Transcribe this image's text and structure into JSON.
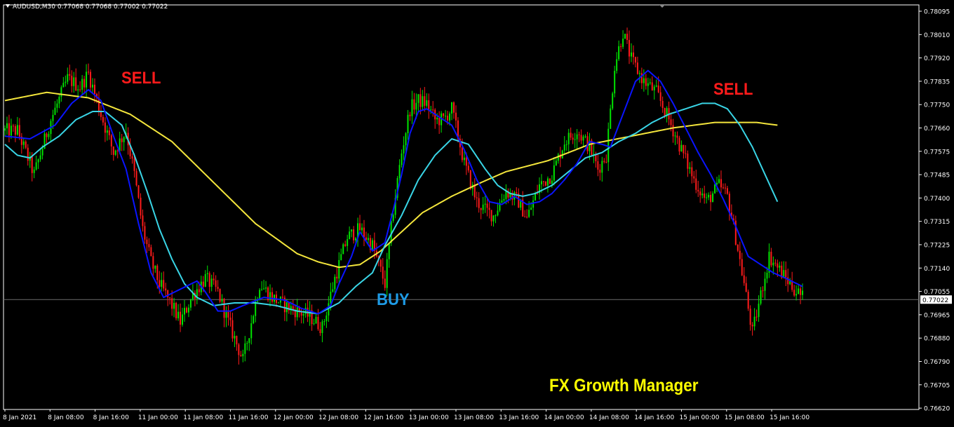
{
  "header": {
    "symbol_info": "AUDUSD,M30  0.77068 0.77068 0.77002 0.77022"
  },
  "annotations": {
    "sell_left": "SELL",
    "sell_right": "SELL",
    "buy": "BUY",
    "brand": "FX Growth Manager"
  },
  "colors": {
    "background": "#000000",
    "bull": "#00e400",
    "bear": "#ff1b1b",
    "ma_fast": "#0a14ff",
    "ma_mid": "#39d5e6",
    "ma_slow": "#f4e63c",
    "axis": "#ffffff",
    "current_price_line": "#6a6a6a"
  },
  "chart_data": {
    "type": "candlestick",
    "symbol": "AUDUSD",
    "timeframe": "M30",
    "ylim": [
      0.7662,
      0.781
    ],
    "y_ticks": [
      "0.78095",
      "0.78010",
      "0.77920",
      "0.77835",
      "0.77750",
      "0.77660",
      "0.77575",
      "0.77485",
      "0.77400",
      "0.77315",
      "0.77225",
      "0.77140",
      "0.77055",
      "0.76965",
      "0.76880",
      "0.76790",
      "0.76705",
      "0.76620"
    ],
    "x_ticks": [
      "8 Jan 2021",
      "8 Jan 08:00",
      "8 Jan 16:00",
      "11 Jan 00:00",
      "11 Jan 08:00",
      "11 Jan 16:00",
      "12 Jan 00:00",
      "12 Jan 08:00",
      "12 Jan 16:00",
      "13 Jan 00:00",
      "13 Jan 08:00",
      "13 Jan 16:00",
      "14 Jan 00:00",
      "14 Jan 08:00",
      "14 Jan 16:00",
      "15 Jan 00:00",
      "15 Jan 08:00",
      "15 Jan 16:00"
    ],
    "current_price": 0.77022,
    "current_price_label": "0.77022",
    "close_path": [
      [
        0,
        0.7764
      ],
      [
        6,
        0.7764
      ],
      [
        14,
        0.7748
      ],
      [
        22,
        0.7768
      ],
      [
        30,
        0.7783
      ],
      [
        36,
        0.778
      ],
      [
        40,
        0.7785
      ],
      [
        46,
        0.777
      ],
      [
        52,
        0.7756
      ],
      [
        58,
        0.7764
      ],
      [
        62,
        0.7748
      ],
      [
        66,
        0.7728
      ],
      [
        70,
        0.7716
      ],
      [
        74,
        0.7708
      ],
      [
        80,
        0.77
      ],
      [
        84,
        0.7694
      ],
      [
        90,
        0.7704
      ],
      [
        96,
        0.771
      ],
      [
        102,
        0.7705
      ],
      [
        106,
        0.7696
      ],
      [
        110,
        0.7688
      ],
      [
        114,
        0.768
      ],
      [
        118,
        0.7694
      ],
      [
        122,
        0.7708
      ],
      [
        128,
        0.7703
      ],
      [
        134,
        0.77
      ],
      [
        140,
        0.7698
      ],
      [
        146,
        0.7696
      ],
      [
        152,
        0.7692
      ],
      [
        158,
        0.771
      ],
      [
        164,
        0.7725
      ],
      [
        170,
        0.7728
      ],
      [
        176,
        0.7722
      ],
      [
        182,
        0.7708
      ],
      [
        186,
        0.7735
      ],
      [
        190,
        0.7756
      ],
      [
        194,
        0.7772
      ],
      [
        198,
        0.7775
      ],
      [
        202,
        0.7774
      ],
      [
        206,
        0.7768
      ],
      [
        210,
        0.7768
      ],
      [
        214,
        0.7772
      ],
      [
        220,
        0.7752
      ],
      [
        226,
        0.7738
      ],
      [
        230,
        0.7735
      ],
      [
        234,
        0.7733
      ],
      [
        240,
        0.7742
      ],
      [
        246,
        0.7738
      ],
      [
        250,
        0.7732
      ],
      [
        256,
        0.7744
      ],
      [
        262,
        0.7748
      ],
      [
        268,
        0.776
      ],
      [
        274,
        0.7764
      ],
      [
        280,
        0.7758
      ],
      [
        284,
        0.775
      ],
      [
        288,
        0.7755
      ],
      [
        292,
        0.7788
      ],
      [
        296,
        0.78
      ],
      [
        300,
        0.779
      ],
      [
        306,
        0.7782
      ],
      [
        312,
        0.7778
      ],
      [
        318,
        0.7768
      ],
      [
        324,
        0.7757
      ],
      [
        330,
        0.7746
      ],
      [
        336,
        0.7738
      ],
      [
        342,
        0.7744
      ],
      [
        346,
        0.774
      ],
      [
        350,
        0.7725
      ],
      [
        354,
        0.7708
      ],
      [
        358,
        0.769
      ],
      [
        362,
        0.7704
      ],
      [
        366,
        0.7718
      ],
      [
        370,
        0.7714
      ],
      [
        374,
        0.771
      ],
      [
        378,
        0.7706
      ],
      [
        382,
        0.7703
      ]
    ],
    "ma_fast": [
      [
        0,
        0.7762
      ],
      [
        12,
        0.7761
      ],
      [
        24,
        0.7766
      ],
      [
        32,
        0.7774
      ],
      [
        40,
        0.7779
      ],
      [
        46,
        0.7775
      ],
      [
        52,
        0.7762
      ],
      [
        58,
        0.775
      ],
      [
        64,
        0.773
      ],
      [
        70,
        0.7712
      ],
      [
        76,
        0.7703
      ],
      [
        84,
        0.7706
      ],
      [
        92,
        0.7709
      ],
      [
        96,
        0.7705
      ],
      [
        102,
        0.7698
      ],
      [
        108,
        0.7698
      ],
      [
        114,
        0.77
      ],
      [
        124,
        0.7703
      ],
      [
        134,
        0.7702
      ],
      [
        142,
        0.7699
      ],
      [
        150,
        0.7697
      ],
      [
        156,
        0.77
      ],
      [
        160,
        0.7708
      ],
      [
        166,
        0.7718
      ],
      [
        170,
        0.7727
      ],
      [
        176,
        0.772
      ],
      [
        182,
        0.7723
      ],
      [
        186,
        0.7735
      ],
      [
        190,
        0.7748
      ],
      [
        194,
        0.7763
      ],
      [
        198,
        0.7771
      ],
      [
        202,
        0.7772
      ],
      [
        208,
        0.7769
      ],
      [
        214,
        0.7766
      ],
      [
        220,
        0.7757
      ],
      [
        226,
        0.7746
      ],
      [
        232,
        0.7738
      ],
      [
        238,
        0.7737
      ],
      [
        244,
        0.774
      ],
      [
        250,
        0.7737
      ],
      [
        256,
        0.7738
      ],
      [
        262,
        0.7741
      ],
      [
        268,
        0.7746
      ],
      [
        274,
        0.7752
      ],
      [
        280,
        0.776
      ],
      [
        286,
        0.7759
      ],
      [
        290,
        0.7758
      ],
      [
        296,
        0.777
      ],
      [
        302,
        0.7782
      ],
      [
        308,
        0.7786
      ],
      [
        314,
        0.7782
      ],
      [
        320,
        0.7774
      ],
      [
        326,
        0.7765
      ],
      [
        332,
        0.7756
      ],
      [
        338,
        0.7748
      ],
      [
        344,
        0.7739
      ],
      [
        350,
        0.7729
      ],
      [
        356,
        0.7718
      ],
      [
        362,
        0.7715
      ],
      [
        368,
        0.7712
      ],
      [
        374,
        0.771
      ],
      [
        382,
        0.7707
      ]
    ],
    "ma_mid": [
      [
        0,
        0.7759
      ],
      [
        6,
        0.7755
      ],
      [
        12,
        0.7754
      ],
      [
        18,
        0.7758
      ],
      [
        26,
        0.7762
      ],
      [
        34,
        0.7768
      ],
      [
        42,
        0.7771
      ],
      [
        48,
        0.7771
      ],
      [
        56,
        0.7766
      ],
      [
        62,
        0.7755
      ],
      [
        68,
        0.7742
      ],
      [
        74,
        0.7728
      ],
      [
        80,
        0.7717
      ],
      [
        86,
        0.7708
      ],
      [
        92,
        0.7703
      ],
      [
        100,
        0.77
      ],
      [
        110,
        0.7701
      ],
      [
        120,
        0.7701
      ],
      [
        130,
        0.77
      ],
      [
        140,
        0.7698
      ],
      [
        150,
        0.7697
      ],
      [
        160,
        0.7701
      ],
      [
        168,
        0.7707
      ],
      [
        176,
        0.7712
      ],
      [
        182,
        0.7722
      ],
      [
        190,
        0.7733
      ],
      [
        198,
        0.7746
      ],
      [
        206,
        0.7755
      ],
      [
        214,
        0.7761
      ],
      [
        222,
        0.7759
      ],
      [
        230,
        0.775
      ],
      [
        236,
        0.7744
      ],
      [
        242,
        0.7741
      ],
      [
        248,
        0.774
      ],
      [
        254,
        0.7741
      ],
      [
        262,
        0.7744
      ],
      [
        270,
        0.7749
      ],
      [
        278,
        0.7754
      ],
      [
        286,
        0.7756
      ],
      [
        294,
        0.776
      ],
      [
        302,
        0.7763
      ],
      [
        310,
        0.7767
      ],
      [
        318,
        0.777
      ],
      [
        326,
        0.7772
      ],
      [
        334,
        0.7774
      ],
      [
        340,
        0.7774
      ],
      [
        346,
        0.7772
      ],
      [
        352,
        0.7766
      ],
      [
        358,
        0.7758
      ],
      [
        364,
        0.7748
      ],
      [
        370,
        0.7738
      ]
    ],
    "ma_slow": [
      [
        0,
        0.7775
      ],
      [
        20,
        0.7778
      ],
      [
        40,
        0.7776
      ],
      [
        60,
        0.777
      ],
      [
        80,
        0.776
      ],
      [
        100,
        0.7745
      ],
      [
        120,
        0.773
      ],
      [
        140,
        0.7719
      ],
      [
        150,
        0.7716
      ],
      [
        160,
        0.7714
      ],
      [
        170,
        0.7715
      ],
      [
        180,
        0.772
      ],
      [
        190,
        0.7727
      ],
      [
        200,
        0.7734
      ],
      [
        214,
        0.774
      ],
      [
        228,
        0.7745
      ],
      [
        240,
        0.7749
      ],
      [
        260,
        0.7753
      ],
      [
        280,
        0.7759
      ],
      [
        300,
        0.7762
      ],
      [
        320,
        0.7765
      ],
      [
        340,
        0.7767
      ],
      [
        360,
        0.7767
      ],
      [
        370,
        0.7766
      ]
    ],
    "signals": [
      {
        "label": "SELL",
        "type": "sell"
      },
      {
        "label": "BUY",
        "type": "buy"
      },
      {
        "label": "SELL",
        "type": "sell"
      }
    ]
  }
}
